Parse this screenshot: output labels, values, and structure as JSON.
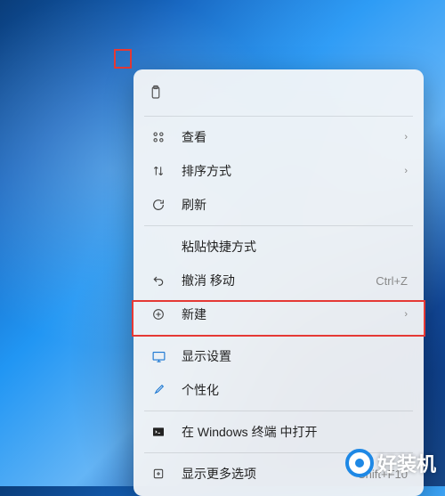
{
  "menu": {
    "view": {
      "label": "查看"
    },
    "sort": {
      "label": "排序方式"
    },
    "refresh": {
      "label": "刷新"
    },
    "paste_shortcut": {
      "label": "粘贴快捷方式"
    },
    "undo_move": {
      "label": "撤消 移动",
      "shortcut": "Ctrl+Z"
    },
    "new": {
      "label": "新建"
    },
    "display_settings": {
      "label": "显示设置"
    },
    "personalize": {
      "label": "个性化"
    },
    "terminal": {
      "label": "在 Windows 终端 中打开"
    },
    "more_options": {
      "label": "显示更多选项",
      "shortcut": "Shift+F10"
    }
  },
  "watermark": {
    "text": "好装机"
  }
}
